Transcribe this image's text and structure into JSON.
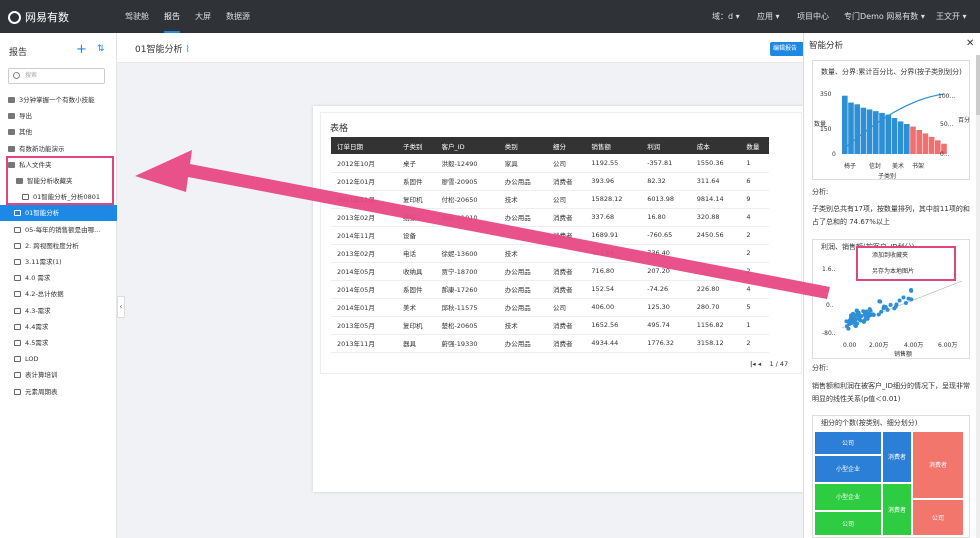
{
  "topbar": {
    "logo": "网易有数",
    "nav": [
      "驾驶舱",
      "报告",
      "大屏",
      "数据源"
    ],
    "right": [
      "域：d ▾",
      "应用 ▾",
      "项目中心",
      "专门Demo 网易有数 ▾",
      "王文开 ▾"
    ]
  },
  "sidebar": {
    "title": "报告",
    "search_placeholder": "搜索",
    "items": [
      "3分钟掌握一个有数小技能",
      "导出",
      "其他",
      "有数新功能演示",
      "私人文件夹",
      "智能分析收藏夹",
      "01智能分析_分析0801",
      "01智能分析",
      "05-每年的销售额是由哪...",
      "2. 跨视图粒度分析",
      "3.11需求(1)",
      "4.0 需求",
      "4.2-总计依据",
      "4.3-需求",
      "4.4需求",
      "4.5需求",
      "LOD",
      "表计算培训",
      "元素周期表"
    ]
  },
  "header": {
    "title": "01智能分析",
    "edit_label": "编辑报告"
  },
  "table": {
    "title": "表格",
    "columns": [
      "订单日期",
      "子类别",
      "客户_ID",
      "类别",
      "细分",
      "销售额",
      "利润",
      "成本",
      "数量"
    ],
    "rows": [
      [
        "2012年10月",
        "桌子",
        "洪毅-12490",
        "家具",
        "公司",
        "1192.55",
        "-357.81",
        "1550.36",
        "1"
      ],
      [
        "2012年01月",
        "系固件",
        "廖雪-20905",
        "办公用品",
        "消费者",
        "393.96",
        "82.32",
        "311.64",
        "6"
      ],
      [
        "2011年11月",
        "复印机",
        "付松-20650",
        "技术",
        "公司",
        "15828.12",
        "6013.98",
        "9814.14",
        "9"
      ],
      [
        "2013年02月",
        "纸张",
        "孙新-21010",
        "办公用品",
        "消费者",
        "337.68",
        "16.80",
        "320.88",
        "4"
      ],
      [
        "2014年11月",
        "设备",
        "",
        "",
        "消费者",
        "1689.91",
        "-760.65",
        "2450.56",
        "2"
      ],
      [
        "2013年02月",
        "电话",
        "徐妮-13600",
        "技术",
        "",
        "413.84",
        "736.40",
        "",
        "2"
      ],
      [
        "2014年05月",
        "收纳具",
        "贾宁-18700",
        "办公用品",
        "消费者",
        "716.80",
        "207.20",
        "",
        "2"
      ],
      [
        "2014年05月",
        "系固件",
        "郝康-17260",
        "办公用品",
        "消费者",
        "152.54",
        "-74.26",
        "226.80",
        "4"
      ],
      [
        "2014年01月",
        "美术",
        "邱秋-11575",
        "办公用品",
        "公司",
        "406.00",
        "125.30",
        "280.70",
        "5"
      ],
      [
        "2013年05月",
        "复印机",
        "楚松-20605",
        "技术",
        "消费者",
        "1652.56",
        "495.74",
        "1156.82",
        "1"
      ],
      [
        "2013年11月",
        "器具",
        "蔚强-19330",
        "办公用品",
        "消费者",
        "4934.44",
        "1776.32",
        "3158.12",
        "2"
      ]
    ],
    "pager": "1 / 47"
  },
  "panel": {
    "title": "智能分析",
    "chart1_title": "数量、分界:累计百分比、分界(按子类别划分)",
    "chart1_yleft_label": "数量",
    "chart1_yright_label": "百分比",
    "chart1_yticks_left": [
      "350",
      "150",
      "0"
    ],
    "chart1_yticks_right": [
      "100...",
      "50...",
      "0..."
    ],
    "chart1_xticks": [
      "椅子",
      "信封",
      "美术",
      "书架"
    ],
    "chart1_xlabel": "子类别",
    "analysis_label": "分析:",
    "analysis1": "子类别总共有17项，按数量排列，其中前11项的和占了总和的 74.67%以上",
    "chart2_title": "利润、销售额(按客户_ID划分)",
    "chart2_yticks": [
      "1.6..",
      "0..",
      "-80.."
    ],
    "chart2_xticks": [
      "0.00",
      "2.00万",
      "4.00万",
      "6.00万"
    ],
    "chart2_xlabel": "销售额",
    "analysis2": "销售额和利润在被客户_ID细分的情况下，呈现非常明显的线性关系(p值＜0.01)",
    "chart3_title": "细分的个数(按类别、细分划分)",
    "chart3_cells": [
      "公司",
      "小型企业",
      "消费者",
      "消费者",
      "小型企业",
      "公司",
      "消费者",
      "公司"
    ],
    "context_menu": [
      "添加到收藏夹",
      "另存为本地图片"
    ]
  },
  "colors": {
    "accent": "#1e88e5",
    "topbar": "#2f3237",
    "highlight": "#e0457b",
    "bar_blue": "#2d8fd5",
    "bar_red": "#f07070",
    "tree_blue": "#2b7fd6",
    "tree_green": "#2ecc40",
    "tree_red": "#f2766b"
  },
  "chart_data": [
    {
      "type": "bar",
      "title": "数量、分界:累计百分比、分界(按子类别划分)",
      "xlabel": "子类别",
      "ylabel": "数量",
      "ylim": [
        0,
        350
      ],
      "series": [
        {
          "name": "数量",
          "values": [
            340,
            300,
            290,
            270,
            260,
            250,
            240,
            230,
            210,
            190,
            175,
            160,
            140,
            120,
            100,
            80,
            60
          ]
        }
      ]
    },
    {
      "type": "scatter",
      "title": "利润、销售额(按客户_ID划分)",
      "xlabel": "销售额",
      "ylabel": "利润"
    },
    {
      "type": "heatmap",
      "title": "细分的个数(按类别、细分划分)"
    }
  ]
}
